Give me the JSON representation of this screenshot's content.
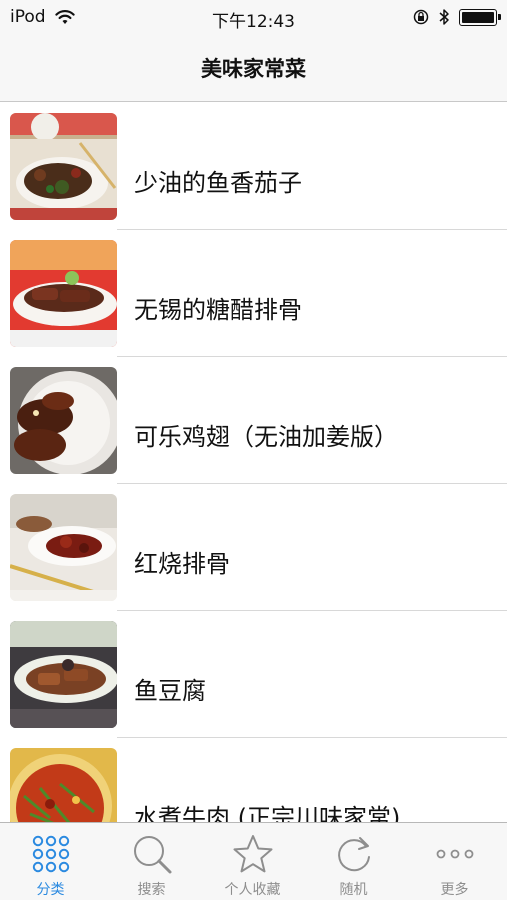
{
  "status": {
    "carrier": "iPod",
    "time": "下午12:43"
  },
  "nav": {
    "title": "美味家常菜"
  },
  "recipes": [
    {
      "title": "少油的鱼香茄子"
    },
    {
      "title": "无锡的糖醋排骨"
    },
    {
      "title": "可乐鸡翅（无油加姜版）"
    },
    {
      "title": "红烧排骨"
    },
    {
      "title": "鱼豆腐"
    },
    {
      "title": "水煮牛肉 (正宗川味家常)"
    }
  ],
  "tabs": [
    {
      "label": "分类",
      "icon": "grid-icon",
      "active": true
    },
    {
      "label": "搜索",
      "icon": "search-icon",
      "active": false
    },
    {
      "label": "个人收藏",
      "icon": "star-icon",
      "active": false
    },
    {
      "label": "随机",
      "icon": "refresh-icon",
      "active": false
    },
    {
      "label": "更多",
      "icon": "more-icon",
      "active": false
    }
  ],
  "colors": {
    "accent": "#2b8ae0",
    "inactive": "#8e8e8e",
    "bar_background": "#f7f7f7"
  }
}
